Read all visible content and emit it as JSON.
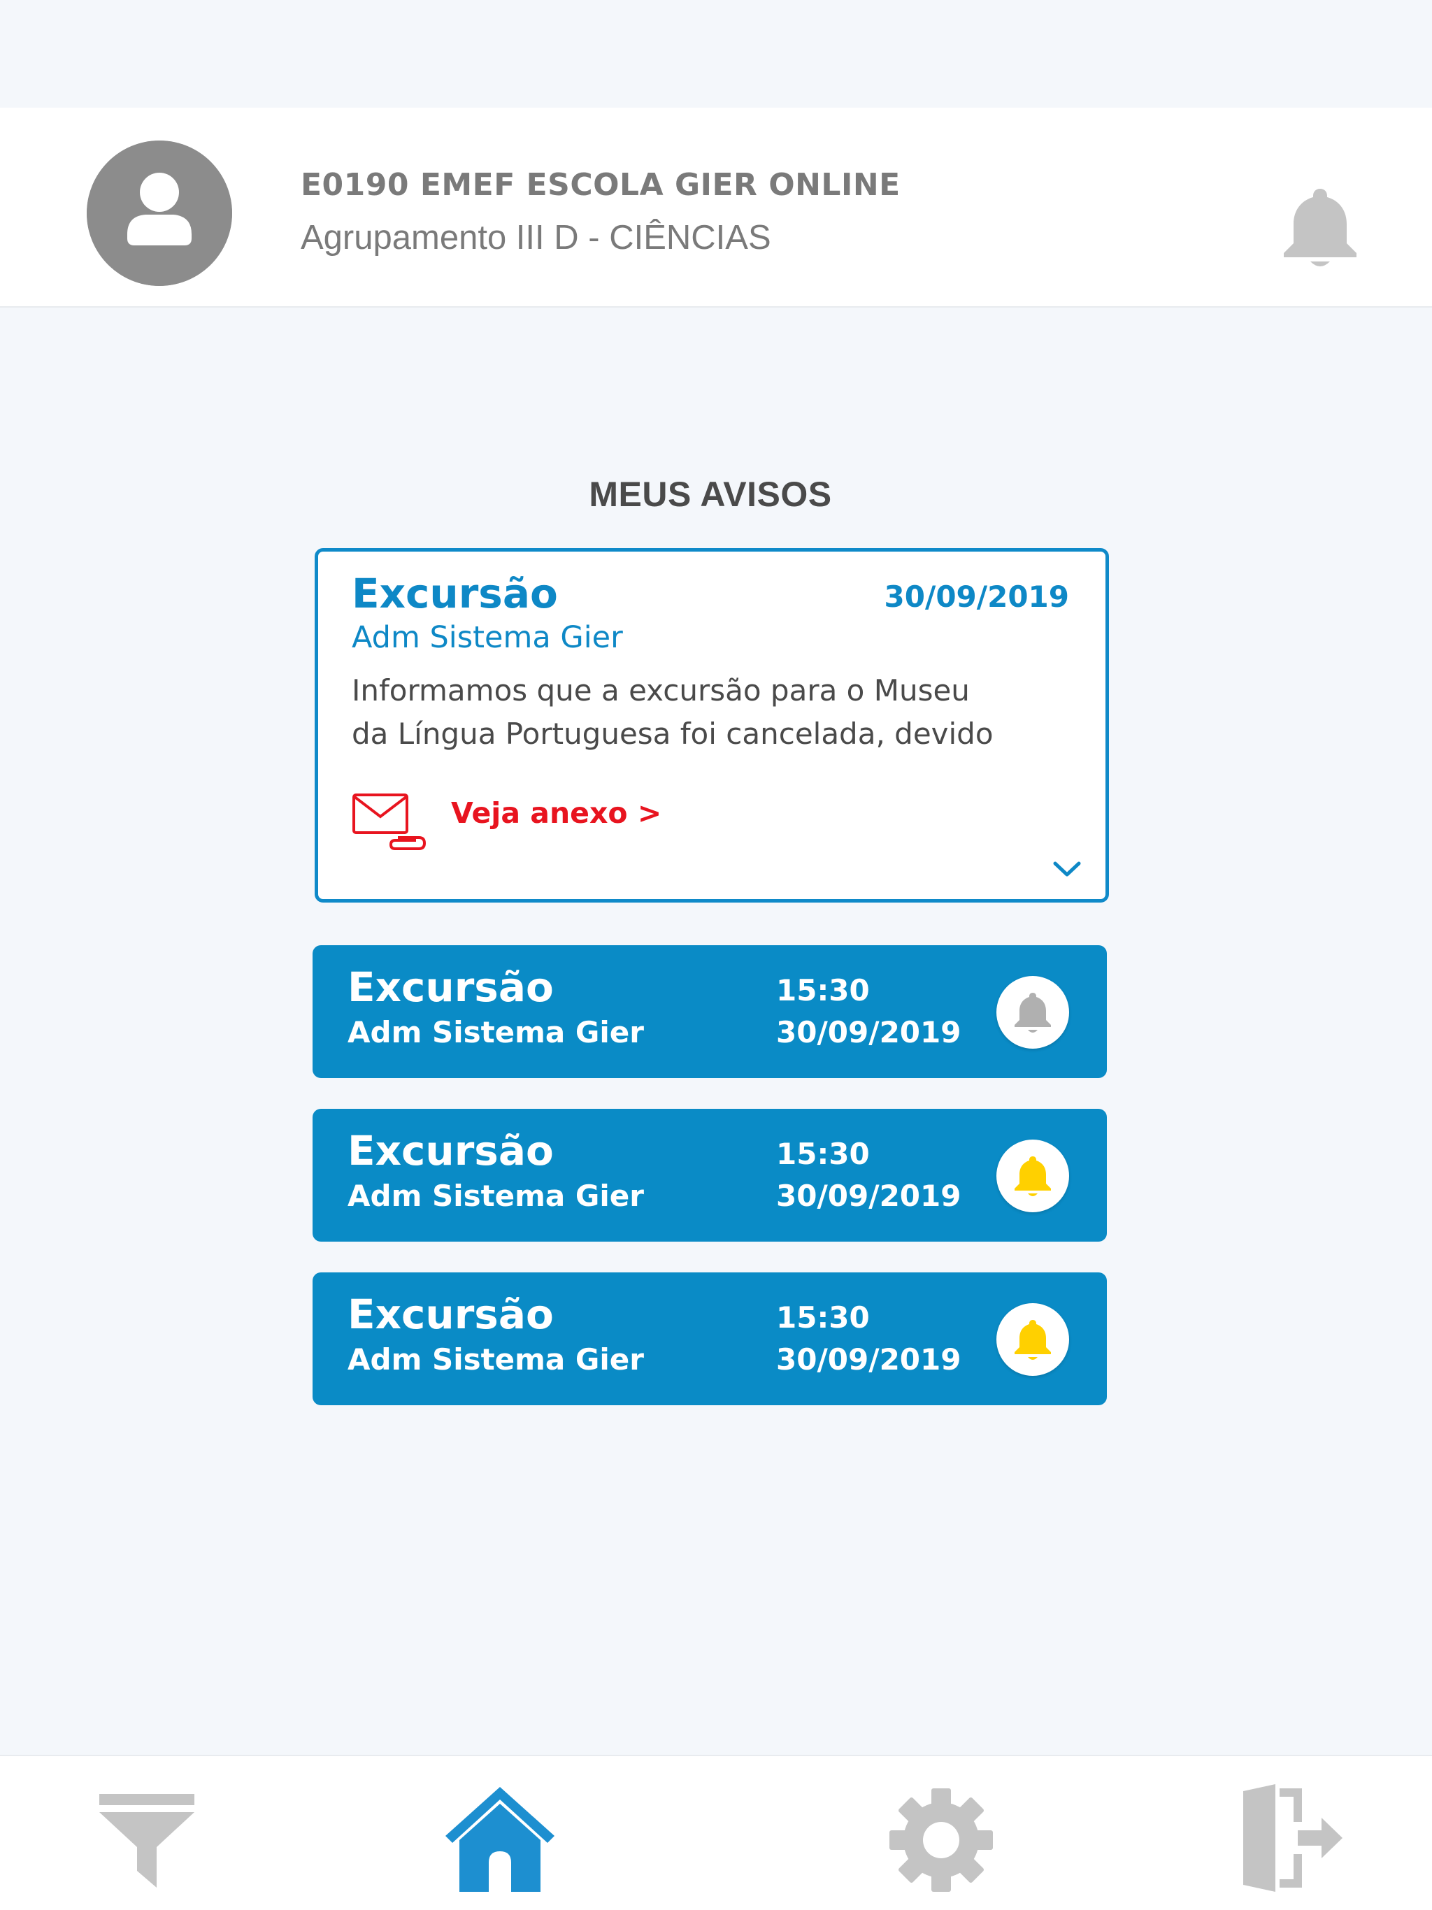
{
  "header": {
    "school_name": "E0190 EMEF ESCOLA GIER ONLINE",
    "class_name": "Agrupamento III D - CIÊNCIAS",
    "avatar_icon": "user-avatar-icon",
    "bell_icon": "bell-icon"
  },
  "section": {
    "title": "MEUS AVISOS"
  },
  "featured_notice": {
    "title": "Excursão",
    "date": "30/09/2019",
    "author": "Adm Sistema Gier",
    "body_line_1": "Informamos que a excursão para o Museu",
    "body_line_2": "da Língua Portuguesa foi cancelada, devido",
    "attachment_label": "Veja anexo >",
    "attachment_icon": "envelope-attachment-icon",
    "expand_icon": "chevron-down-icon"
  },
  "notices": [
    {
      "title": "Excursão",
      "author": "Adm Sistema Gier",
      "time": "15:30",
      "date": "30/09/2019",
      "bell_state": "read",
      "bell_color": "#b0b0b0"
    },
    {
      "title": "Excursão",
      "author": "Adm Sistema Gier",
      "time": "15:30",
      "date": "30/09/2019",
      "bell_state": "unread",
      "bell_color": "#ffd000"
    },
    {
      "title": "Excursão",
      "author": "Adm Sistema Gier",
      "time": "15:30",
      "date": "30/09/2019",
      "bell_state": "unread",
      "bell_color": "#ffd000"
    }
  ],
  "tabbar": {
    "items": [
      {
        "icon": "filter-icon",
        "active": false
      },
      {
        "icon": "home-icon",
        "active": true
      },
      {
        "icon": "gear-icon",
        "active": false
      },
      {
        "icon": "logout-icon",
        "active": false
      }
    ]
  },
  "colors": {
    "primary": "#0a8bc6",
    "link_red": "#e8141f",
    "icon_gray": "#c4c4c4",
    "bell_active": "#ffd000"
  }
}
